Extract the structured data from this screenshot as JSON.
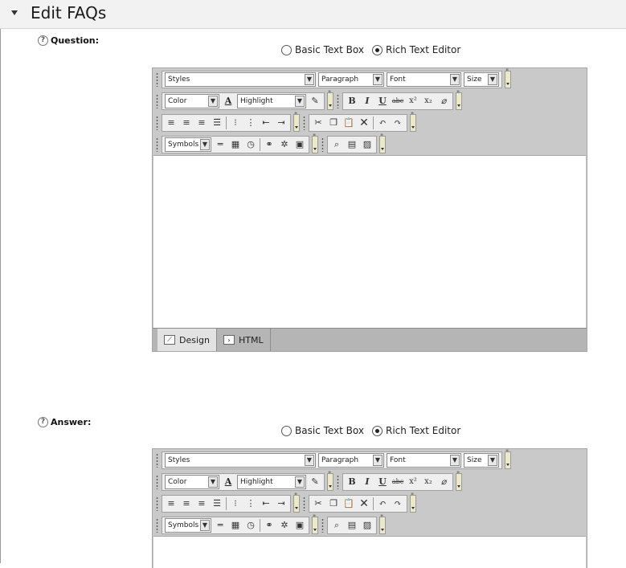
{
  "header": {
    "title": "Edit FAQs"
  },
  "fields": [
    {
      "label": "Question:",
      "mode": {
        "basic_label": "Basic Text Box",
        "rich_label": "Rich Text Editor",
        "selected": "rich"
      }
    },
    {
      "label": "Answer:",
      "mode": {
        "basic_label": "Basic Text Box",
        "rich_label": "Rich Text Editor",
        "selected": "rich"
      }
    }
  ],
  "editor": {
    "styles": "Styles",
    "paragraph": "Paragraph",
    "font": "Font",
    "size": "Size",
    "color": "Color",
    "highlight": "Highlight",
    "symbols": "Symbols",
    "bold": "B",
    "italic": "I",
    "underline": "U",
    "strike": "abc",
    "superscript": "x²",
    "subscript": "x₂",
    "color_a": "A",
    "tabs": {
      "design": "Design",
      "html": "HTML"
    }
  }
}
